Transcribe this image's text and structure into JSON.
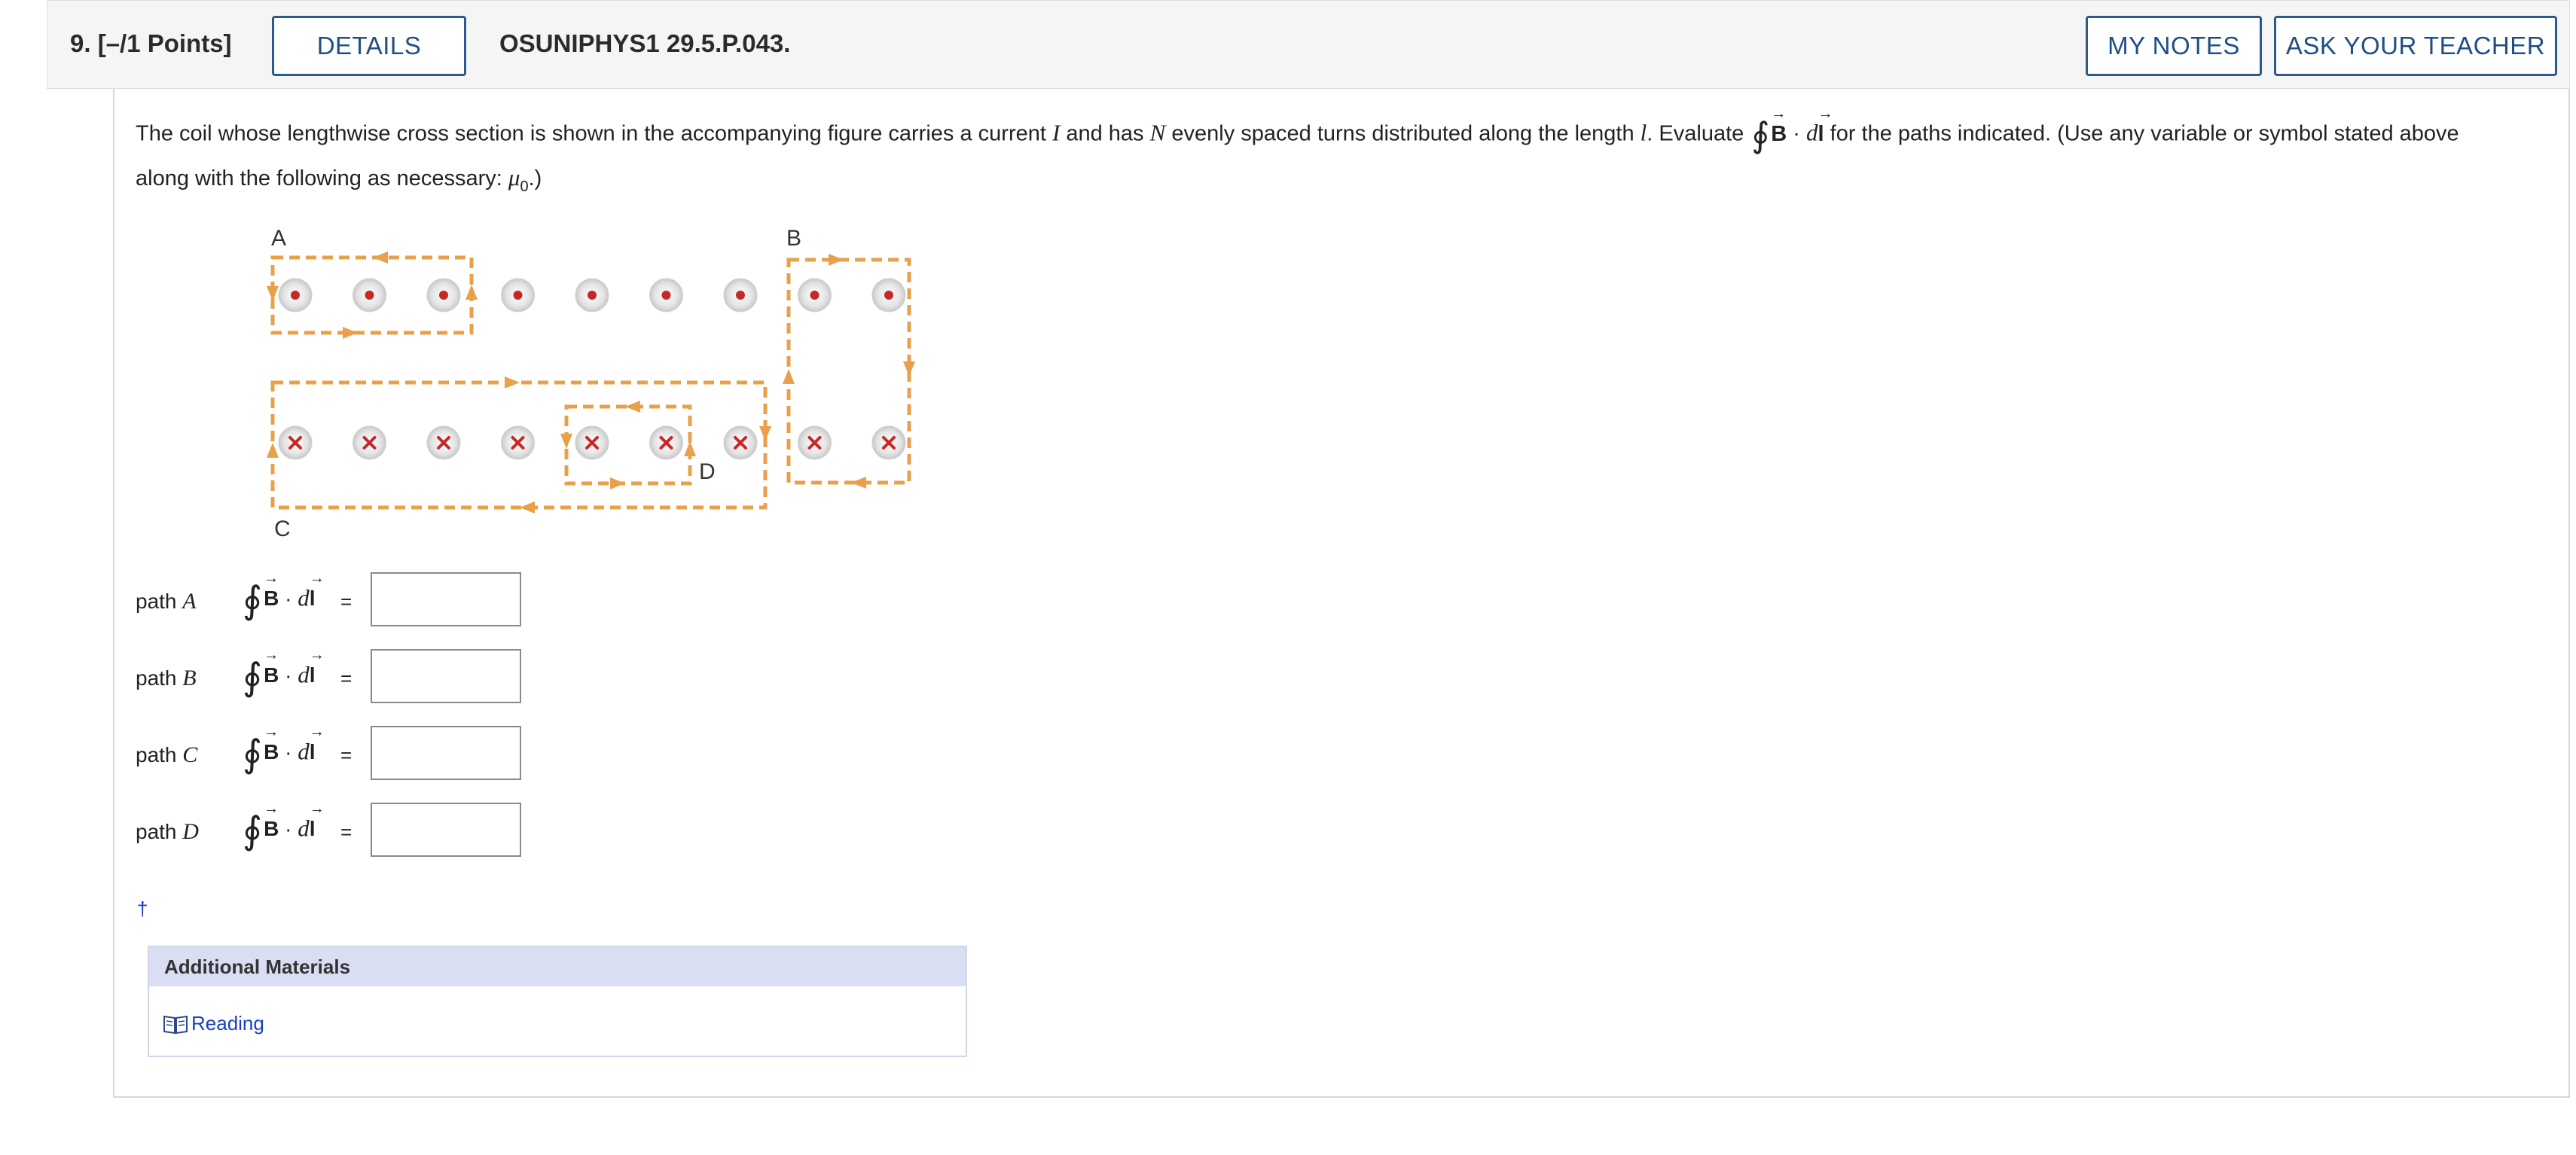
{
  "header": {
    "question_number": "9.  [–/1 Points]",
    "details_label": "DETAILS",
    "question_code": "OSUNIPHYS1 29.5.P.043.",
    "my_notes_label": "MY NOTES",
    "ask_teacher_label": "ASK YOUR TEACHER"
  },
  "prompt": {
    "part1": "The coil whose lengthwise cross section is shown in the accompanying figure carries a current ",
    "var_I": "I",
    "part2": " and has ",
    "var_N": "N",
    "part3": " evenly spaced turns distributed along the length ",
    "var_l": "l",
    "part4": ". Evaluate ",
    "integral_B": "B",
    "integral_dot": " · ",
    "integral_d": "d",
    "integral_l": "l",
    "part5": " for the paths indicated. (Use any variable or symbol stated above",
    "line2_text": "along with the following as necessary: ",
    "mu": "μ",
    "mu_sub": "0",
    "line2_end": ".)"
  },
  "figure": {
    "label_a": "A",
    "label_b": "B",
    "label_c": "C",
    "label_d": "D",
    "dot_count_top": 9,
    "cross_count_bottom": 9,
    "path_color": "#e8a04a",
    "dot_color": "#c62828"
  },
  "paths": [
    {
      "label": "path ",
      "var": "A",
      "value": ""
    },
    {
      "label": "path ",
      "var": "B",
      "value": ""
    },
    {
      "label": "path ",
      "var": "C",
      "value": ""
    },
    {
      "label": "path ",
      "var": "D",
      "value": ""
    }
  ],
  "integral_symbol": {
    "oint": "∮",
    "B": "B",
    "dot": " · ",
    "d": "d",
    "l": "l",
    "eq": "="
  },
  "dagger": "†",
  "additional": {
    "title": "Additional Materials",
    "reading": "Reading"
  }
}
